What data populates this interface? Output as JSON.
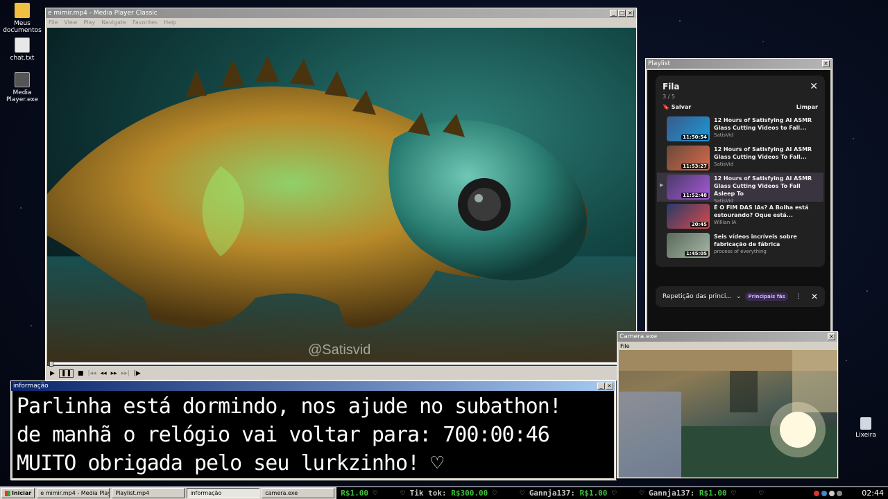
{
  "desktop": {
    "icons": [
      {
        "label": "Meus documentos",
        "color": "#f0c040"
      },
      {
        "label": "chat.txt",
        "color": "#e8e8e8"
      },
      {
        "label": "Media Player.exe",
        "color": "#555555"
      },
      {
        "label": "Lixeira",
        "color": "#d0d8e0"
      }
    ]
  },
  "mpc": {
    "title": "e mimir.mp4 - Media Player Classic",
    "menu": [
      "File",
      "View",
      "Play",
      "Navigate",
      "Favorites",
      "Help"
    ],
    "watermark": "@Satisvid"
  },
  "playlist": {
    "window_title": "Playlist",
    "queue_title": "Fila",
    "position": "3 / 5",
    "save_label": "Salvar",
    "clear_label": "Limpar",
    "items": [
      {
        "title": "12 Hours of Satisfying AI ASMR Glass Cutting Videos to Fall...",
        "channel": "SatisVid",
        "duration": "11:50:54",
        "thumb": "#3a5a8a"
      },
      {
        "title": "12 Hours of Satisfying AI ASMR Glass Cutting Videos To Fall...",
        "channel": "SatisVid",
        "duration": "11:53:27",
        "thumb": "#6a4a3a"
      },
      {
        "title": "12 Hours of Satisfying AI ASMR Glass Cutting Videos To Fall Asleep To",
        "channel": "SatisVid",
        "duration": "11:52:48",
        "thumb": "#4a3a6a"
      },
      {
        "title": "É O FIM DAS IAs? A Bolha está estourando? Oque está...",
        "channel": "Willian IA",
        "duration": "20:45",
        "thumb": "#2a3a6a"
      },
      {
        "title": "Seis vídeos incríveis sobre fabricação de fábrica",
        "channel": "process of everything",
        "duration": "1:45:05",
        "thumb": "#5a6a5a"
      }
    ],
    "footer_text": "Repetição das princi...",
    "footer_chip": "Principais fãs"
  },
  "info": {
    "title": "informação",
    "lines": [
      "Parlinha está dormindo, nos ajude no subathon!",
      "de manhã o relógio vai voltar para:  700:00:46",
      "MUITO obrigada pelo seu lurkzinho! ♡"
    ]
  },
  "camera": {
    "title": "Camera.exe",
    "menu": "File"
  },
  "taskbar": {
    "start_label": "Iniciar",
    "tasks": [
      {
        "label": "e mimir.mp4 - Media Playe..."
      },
      {
        "label": "Playlist.mp4"
      },
      {
        "label": "informação"
      },
      {
        "label": "camera.exe"
      }
    ],
    "ticker": [
      {
        "text": "",
        "money": "R$1.00",
        "tail": " ♡     ♡ "
      },
      {
        "text": "Tik tok: ",
        "money": "R$300.00",
        "tail": " ♡     ♡ "
      },
      {
        "text": "Gannja137: ",
        "money": "R$1.00",
        "tail": " ♡     ♡ "
      },
      {
        "text": "Gannja137: ",
        "money": "R$1.00",
        "tail": " ♡     ♡"
      }
    ],
    "clock": "02:44"
  }
}
